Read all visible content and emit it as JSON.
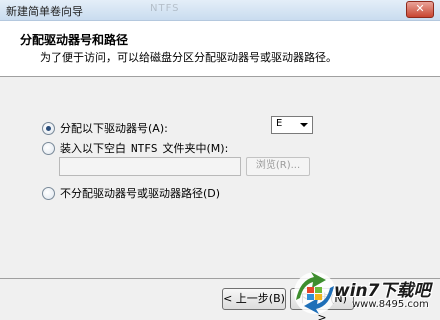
{
  "window": {
    "title": "新建简单卷向导",
    "title_background_text": "NTFS",
    "close_label": "✕"
  },
  "header": {
    "title": "分配驱动器号和路径",
    "description": "为了便于访问，可以给磁盘分区分配驱动器号或驱动器路径。"
  },
  "options": {
    "assign_letter": {
      "label": "分配以下驱动器号(A):",
      "checked": true
    },
    "mount_folder": {
      "label_prefix": "装入以下空白",
      "label_fs": "NTFS",
      "label_suffix": "文件夹中(M):",
      "checked": false
    },
    "no_assign": {
      "label": "不分配驱动器号或驱动器路径(D)",
      "checked": false
    }
  },
  "drive_letter": {
    "value": "E"
  },
  "path": {
    "value": ""
  },
  "buttons": {
    "browse": "浏览(R)...",
    "back": "< 上一步(B)",
    "next": "下一步(N) >"
  },
  "watermark": {
    "title": "win7下载吧",
    "url": "www.8495.com",
    "logo": "win7-logo-icon"
  }
}
